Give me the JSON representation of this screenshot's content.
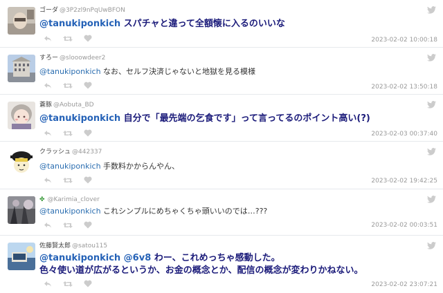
{
  "tweets": [
    {
      "name": "ゴーダ",
      "handle": "@3P2zl9nPqUwBFON",
      "mention": "@tanukiponkich",
      "text": " スパチャと違って全額懐に入るのいいな",
      "time": "2023-02-02 10:00:18"
    },
    {
      "name": "すろー",
      "handle": "@slooowdeer2",
      "mention": "@tanukiponkich",
      "text": " なお、セルフ決済じゃないと地獄を見る模様",
      "time": "2023-02-02 13:50:18"
    },
    {
      "name": "蒼豚",
      "handle": "@Aobuta_BD",
      "mention": "@tanukiponkich",
      "text": " 自分で「最先端の乞食です」って言ってるのポイント高い(?)",
      "time": "2023-02-03 00:37:40"
    },
    {
      "name": "クラッシュ",
      "handle": "@442337",
      "mention": "@tanukiponkich",
      "text": " 手数料かからんやん、",
      "time": "2023-02-02 19:42:25"
    },
    {
      "name": "",
      "handle": "@Karimia_clover",
      "mention": "@tanukiponkich",
      "text": " これシンプルにめちゃくちゃ頭いいのでは…???",
      "time": "2023-02-02 00:03:51"
    },
    {
      "name": "佐藤賢太郎",
      "handle": "@satou115",
      "mention": "@tanukiponkich @6v8",
      "text": " わー、これめっちゃ感動した。",
      "text2": "色々使い道が広がるというか、お金の概念とか、配信の概念が変わりかねない。",
      "time": "2023-02-02 23:07:21"
    }
  ],
  "icons": {
    "bird": "twitter-bird-icon",
    "reply": "reply-icon",
    "retweet": "retweet-icon",
    "like": "heart-icon",
    "clover": "clover-icon"
  },
  "colors": {
    "mention": "#2a6db0",
    "bold_text": "#1b1b7a",
    "meta": "#999999",
    "icon": "#cccccc"
  }
}
